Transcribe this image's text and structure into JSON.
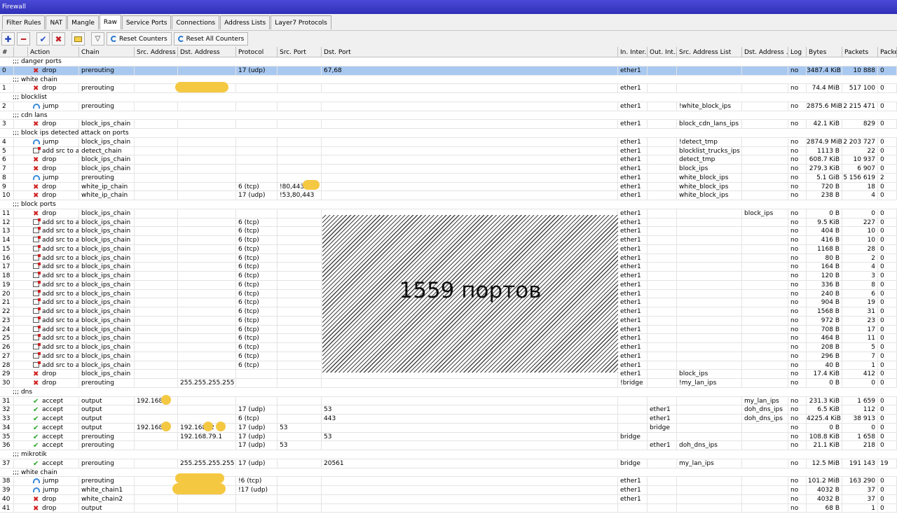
{
  "window": {
    "title": "Firewall"
  },
  "tabs": [
    "Filter Rules",
    "NAT",
    "Mangle",
    "Raw",
    "Service Ports",
    "Connections",
    "Address Lists",
    "Layer7 Protocols"
  ],
  "active_tab": "Raw",
  "toolbar": {
    "reset_counters": "Reset Counters",
    "reset_all_counters": "Reset All Counters"
  },
  "columns": [
    "#",
    "Action",
    "Chain",
    "Src. Address",
    "Dst. Address",
    "Protocol",
    "Src. Port",
    "Dst. Port",
    "In. Inter...",
    "Out. Int...",
    "Src. Address List",
    "Dst. Address ...",
    "Log",
    "Bytes",
    "Packets",
    "Packe"
  ],
  "overlay_text": "1559 портов",
  "rows": [
    {
      "type": "comment",
      "text": ";;; danger ports",
      "sel": true
    },
    {
      "type": "rule",
      "n": "0",
      "icon": "drop",
      "action": "drop",
      "chain": "prerouting",
      "src": "",
      "dst": "",
      "proto": "17 (udp)",
      "sport": "",
      "dport": "67,68",
      "in": "ether1",
      "out": "",
      "srclist": "",
      "dstlist": "",
      "log": "no",
      "bytes": "3487.4 KiB",
      "packets": "10 888",
      "pr": "0",
      "sel": true
    },
    {
      "type": "comment",
      "text": ";;; white chain"
    },
    {
      "type": "rule",
      "n": "1",
      "icon": "drop",
      "action": "drop",
      "chain": "prerouting",
      "src": "",
      "dst": "",
      "proto": "",
      "sport": "",
      "dport": "",
      "in": "ether1",
      "out": "",
      "srclist": "",
      "dstlist": "",
      "log": "no",
      "bytes": "74.4 MiB",
      "packets": "517 100",
      "pr": "0"
    },
    {
      "type": "comment",
      "text": ";;; blocklist"
    },
    {
      "type": "rule",
      "n": "2",
      "icon": "jump",
      "action": "jump",
      "chain": "prerouting",
      "src": "",
      "dst": "",
      "proto": "",
      "sport": "",
      "dport": "",
      "in": "ether1",
      "out": "",
      "srclist": "!white_block_ips",
      "dstlist": "",
      "log": "no",
      "bytes": "2875.6 MiB",
      "packets": "2 215 471",
      "pr": "0"
    },
    {
      "type": "comment",
      "text": ";;; cdn lans"
    },
    {
      "type": "rule",
      "n": "3",
      "icon": "drop",
      "action": "drop",
      "chain": "block_ips_chain",
      "src": "",
      "dst": "",
      "proto": "",
      "sport": "",
      "dport": "",
      "in": "ether1",
      "out": "",
      "srclist": "block_cdn_lans_ips",
      "dstlist": "",
      "log": "no",
      "bytes": "42.1 KiB",
      "packets": "829",
      "pr": "0"
    },
    {
      "type": "comment",
      "text": ";;; block ips detected attack on ports"
    },
    {
      "type": "rule",
      "n": "4",
      "icon": "jump",
      "action": "jump",
      "chain": "block_ips_chain",
      "src": "",
      "dst": "",
      "proto": "",
      "sport": "",
      "dport": "",
      "in": "ether1",
      "out": "",
      "srclist": "!detect_tmp",
      "dstlist": "",
      "log": "no",
      "bytes": "2874.9 MiB",
      "packets": "2 203 727",
      "pr": "0"
    },
    {
      "type": "rule",
      "n": "5",
      "icon": "add",
      "action": "add src to a...",
      "chain": "detect_chain",
      "src": "",
      "dst": "",
      "proto": "",
      "sport": "",
      "dport": "",
      "in": "ether1",
      "out": "",
      "srclist": "blocklist_trucks_ips",
      "dstlist": "",
      "log": "no",
      "bytes": "1113 B",
      "packets": "22",
      "pr": "0"
    },
    {
      "type": "rule",
      "n": "6",
      "icon": "drop",
      "action": "drop",
      "chain": "block_ips_chain",
      "src": "",
      "dst": "",
      "proto": "",
      "sport": "",
      "dport": "",
      "in": "ether1",
      "out": "",
      "srclist": "detect_tmp",
      "dstlist": "",
      "log": "no",
      "bytes": "608.7 KiB",
      "packets": "10 937",
      "pr": "0"
    },
    {
      "type": "rule",
      "n": "7",
      "icon": "drop",
      "action": "drop",
      "chain": "block_ips_chain",
      "src": "",
      "dst": "",
      "proto": "",
      "sport": "",
      "dport": "",
      "in": "ether1",
      "out": "",
      "srclist": "block_ips",
      "dstlist": "",
      "log": "no",
      "bytes": "279.3 KiB",
      "packets": "6 907",
      "pr": "0"
    },
    {
      "type": "rule",
      "n": "8",
      "icon": "jump",
      "action": "jump",
      "chain": "prerouting",
      "src": "",
      "dst": "",
      "proto": "",
      "sport": "",
      "dport": "",
      "in": "ether1",
      "out": "",
      "srclist": "white_block_ips",
      "dstlist": "",
      "log": "no",
      "bytes": "5.1 GiB",
      "packets": "5 156 619",
      "pr": "2"
    },
    {
      "type": "rule",
      "n": "9",
      "icon": "drop",
      "action": "drop",
      "chain": "white_ip_chain",
      "src": "",
      "dst": "",
      "proto": "6 (tcp)",
      "sport": "!80,443,",
      "dport": "",
      "in": "ether1",
      "out": "",
      "srclist": "white_block_ips",
      "dstlist": "",
      "log": "no",
      "bytes": "720 B",
      "packets": "18",
      "pr": "0"
    },
    {
      "type": "rule",
      "n": "10",
      "icon": "drop",
      "action": "drop",
      "chain": "white_ip_chain",
      "src": "",
      "dst": "",
      "proto": "17 (udp)",
      "sport": "!53,80,443",
      "dport": "",
      "in": "ether1",
      "out": "",
      "srclist": "white_block_ips",
      "dstlist": "",
      "log": "no",
      "bytes": "238 B",
      "packets": "4",
      "pr": "0"
    },
    {
      "type": "comment",
      "text": ";;; block ports"
    },
    {
      "type": "rule",
      "n": "11",
      "icon": "drop",
      "action": "drop",
      "chain": "block_ips_chain",
      "src": "",
      "dst": "",
      "proto": "",
      "sport": "",
      "dport": "",
      "in": "ether1",
      "out": "",
      "srclist": "",
      "dstlist": "block_ips",
      "log": "no",
      "bytes": "0 B",
      "packets": "0",
      "pr": "0"
    },
    {
      "type": "rule",
      "n": "12",
      "icon": "add",
      "action": "add src to a...",
      "chain": "block_ips_chain",
      "src": "",
      "dst": "",
      "proto": "6 (tcp)",
      "sport": "",
      "dport": "",
      "in": "ether1",
      "out": "",
      "srclist": "",
      "dstlist": "",
      "log": "no",
      "bytes": "9.5 KiB",
      "packets": "227",
      "pr": "0"
    },
    {
      "type": "rule",
      "n": "13",
      "icon": "add",
      "action": "add src to a...",
      "chain": "block_ips_chain",
      "src": "",
      "dst": "",
      "proto": "6 (tcp)",
      "sport": "",
      "dport": "",
      "in": "ether1",
      "out": "",
      "srclist": "",
      "dstlist": "",
      "log": "no",
      "bytes": "404 B",
      "packets": "10",
      "pr": "0"
    },
    {
      "type": "rule",
      "n": "14",
      "icon": "add",
      "action": "add src to a...",
      "chain": "block_ips_chain",
      "src": "",
      "dst": "",
      "proto": "6 (tcp)",
      "sport": "",
      "dport": "",
      "in": "ether1",
      "out": "",
      "srclist": "",
      "dstlist": "",
      "log": "no",
      "bytes": "416 B",
      "packets": "10",
      "pr": "0"
    },
    {
      "type": "rule",
      "n": "15",
      "icon": "add",
      "action": "add src to a...",
      "chain": "block_ips_chain",
      "src": "",
      "dst": "",
      "proto": "6 (tcp)",
      "sport": "",
      "dport": "",
      "in": "ether1",
      "out": "",
      "srclist": "",
      "dstlist": "",
      "log": "no",
      "bytes": "1168 B",
      "packets": "28",
      "pr": "0"
    },
    {
      "type": "rule",
      "n": "16",
      "icon": "add",
      "action": "add src to a...",
      "chain": "block_ips_chain",
      "src": "",
      "dst": "",
      "proto": "6 (tcp)",
      "sport": "",
      "dport": "",
      "in": "ether1",
      "out": "",
      "srclist": "",
      "dstlist": "",
      "log": "no",
      "bytes": "80 B",
      "packets": "2",
      "pr": "0"
    },
    {
      "type": "rule",
      "n": "17",
      "icon": "add",
      "action": "add src to a...",
      "chain": "block_ips_chain",
      "src": "",
      "dst": "",
      "proto": "6 (tcp)",
      "sport": "",
      "dport": "",
      "in": "ether1",
      "out": "",
      "srclist": "",
      "dstlist": "",
      "log": "no",
      "bytes": "164 B",
      "packets": "4",
      "pr": "0"
    },
    {
      "type": "rule",
      "n": "18",
      "icon": "add",
      "action": "add src to a...",
      "chain": "block_ips_chain",
      "src": "",
      "dst": "",
      "proto": "6 (tcp)",
      "sport": "",
      "dport": "",
      "in": "ether1",
      "out": "",
      "srclist": "",
      "dstlist": "",
      "log": "no",
      "bytes": "120 B",
      "packets": "3",
      "pr": "0"
    },
    {
      "type": "rule",
      "n": "19",
      "icon": "add",
      "action": "add src to a...",
      "chain": "block_ips_chain",
      "src": "",
      "dst": "",
      "proto": "6 (tcp)",
      "sport": "",
      "dport": "",
      "in": "ether1",
      "out": "",
      "srclist": "",
      "dstlist": "",
      "log": "no",
      "bytes": "336 B",
      "packets": "8",
      "pr": "0"
    },
    {
      "type": "rule",
      "n": "20",
      "icon": "add",
      "action": "add src to a...",
      "chain": "block_ips_chain",
      "src": "",
      "dst": "",
      "proto": "6 (tcp)",
      "sport": "",
      "dport": "",
      "in": "ether1",
      "out": "",
      "srclist": "",
      "dstlist": "",
      "log": "no",
      "bytes": "240 B",
      "packets": "6",
      "pr": "0"
    },
    {
      "type": "rule",
      "n": "21",
      "icon": "add",
      "action": "add src to a...",
      "chain": "block_ips_chain",
      "src": "",
      "dst": "",
      "proto": "6 (tcp)",
      "sport": "",
      "dport": "",
      "in": "ether1",
      "out": "",
      "srclist": "",
      "dstlist": "",
      "log": "no",
      "bytes": "904 B",
      "packets": "19",
      "pr": "0"
    },
    {
      "type": "rule",
      "n": "22",
      "icon": "add",
      "action": "add src to a...",
      "chain": "block_ips_chain",
      "src": "",
      "dst": "",
      "proto": "6 (tcp)",
      "sport": "",
      "dport": "",
      "in": "ether1",
      "out": "",
      "srclist": "",
      "dstlist": "",
      "log": "no",
      "bytes": "1568 B",
      "packets": "31",
      "pr": "0"
    },
    {
      "type": "rule",
      "n": "23",
      "icon": "add",
      "action": "add src to a...",
      "chain": "block_ips_chain",
      "src": "",
      "dst": "",
      "proto": "6 (tcp)",
      "sport": "",
      "dport": "",
      "in": "ether1",
      "out": "",
      "srclist": "",
      "dstlist": "",
      "log": "no",
      "bytes": "972 B",
      "packets": "23",
      "pr": "0"
    },
    {
      "type": "rule",
      "n": "24",
      "icon": "add",
      "action": "add src to a...",
      "chain": "block_ips_chain",
      "src": "",
      "dst": "",
      "proto": "6 (tcp)",
      "sport": "",
      "dport": "",
      "in": "ether1",
      "out": "",
      "srclist": "",
      "dstlist": "",
      "log": "no",
      "bytes": "708 B",
      "packets": "17",
      "pr": "0"
    },
    {
      "type": "rule",
      "n": "25",
      "icon": "add",
      "action": "add src to a...",
      "chain": "block_ips_chain",
      "src": "",
      "dst": "",
      "proto": "6 (tcp)",
      "sport": "",
      "dport": "",
      "in": "ether1",
      "out": "",
      "srclist": "",
      "dstlist": "",
      "log": "no",
      "bytes": "464 B",
      "packets": "11",
      "pr": "0"
    },
    {
      "type": "rule",
      "n": "26",
      "icon": "add",
      "action": "add src to a...",
      "chain": "block_ips_chain",
      "src": "",
      "dst": "",
      "proto": "6 (tcp)",
      "sport": "",
      "dport": "",
      "in": "ether1",
      "out": "",
      "srclist": "",
      "dstlist": "",
      "log": "no",
      "bytes": "208 B",
      "packets": "5",
      "pr": "0"
    },
    {
      "type": "rule",
      "n": "27",
      "icon": "add",
      "action": "add src to a...",
      "chain": "block_ips_chain",
      "src": "",
      "dst": "",
      "proto": "6 (tcp)",
      "sport": "",
      "dport": "",
      "in": "ether1",
      "out": "",
      "srclist": "",
      "dstlist": "",
      "log": "no",
      "bytes": "296 B",
      "packets": "7",
      "pr": "0"
    },
    {
      "type": "rule",
      "n": "28",
      "icon": "add",
      "action": "add src to a...",
      "chain": "block_ips_chain",
      "src": "",
      "dst": "",
      "proto": "6 (tcp)",
      "sport": "",
      "dport": "",
      "in": "ether1",
      "out": "",
      "srclist": "",
      "dstlist": "",
      "log": "no",
      "bytes": "40 B",
      "packets": "1",
      "pr": "0"
    },
    {
      "type": "rule",
      "n": "29",
      "icon": "drop",
      "action": "drop",
      "chain": "block_ips_chain",
      "src": "",
      "dst": "",
      "proto": "",
      "sport": "",
      "dport": "",
      "in": "ether1",
      "out": "",
      "srclist": "block_ips",
      "dstlist": "",
      "log": "no",
      "bytes": "17.4 KiB",
      "packets": "412",
      "pr": "0"
    },
    {
      "type": "rule",
      "n": "30",
      "icon": "drop",
      "action": "drop",
      "chain": "prerouting",
      "src": "",
      "dst": "255.255.255.255",
      "proto": "",
      "sport": "",
      "dport": "",
      "in": "!bridge",
      "out": "",
      "srclist": "!my_lan_ips",
      "dstlist": "",
      "log": "no",
      "bytes": "0 B",
      "packets": "0",
      "pr": "0"
    },
    {
      "type": "comment",
      "text": ";;; dns"
    },
    {
      "type": "rule",
      "n": "31",
      "icon": "accept",
      "action": "accept",
      "chain": "output",
      "src": "192.168.    1",
      "dst": "",
      "proto": "",
      "sport": "",
      "dport": "",
      "in": "",
      "out": "",
      "srclist": "",
      "dstlist": "my_lan_ips",
      "log": "no",
      "bytes": "231.3 KiB",
      "packets": "1 659",
      "pr": "0"
    },
    {
      "type": "rule",
      "n": "32",
      "icon": "accept",
      "action": "accept",
      "chain": "output",
      "src": "",
      "dst": "",
      "proto": "17 (udp)",
      "sport": "",
      "dport": "53",
      "in": "",
      "out": "ether1",
      "srclist": "",
      "dstlist": "doh_dns_ips",
      "log": "no",
      "bytes": "6.5 KiB",
      "packets": "112",
      "pr": "0"
    },
    {
      "type": "rule",
      "n": "33",
      "icon": "accept",
      "action": "accept",
      "chain": "output",
      "src": "",
      "dst": "",
      "proto": "6 (tcp)",
      "sport": "",
      "dport": "443",
      "in": "",
      "out": "ether1",
      "srclist": "",
      "dstlist": "doh_dns_ips",
      "log": "no",
      "bytes": "4225.4 KiB",
      "packets": "38 913",
      "pr": "0"
    },
    {
      "type": "rule",
      "n": "34",
      "icon": "accept",
      "action": "accept",
      "chain": "output",
      "src": "192.168.    1",
      "dst": "192.168.    2",
      "proto": "17 (udp)",
      "sport": "53",
      "dport": "",
      "in": "",
      "out": "bridge",
      "srclist": "",
      "dstlist": "",
      "log": "no",
      "bytes": "0 B",
      "packets": "0",
      "pr": "0"
    },
    {
      "type": "rule",
      "n": "35",
      "icon": "accept",
      "action": "accept",
      "chain": "prerouting",
      "src": "",
      "dst": "192.168.79.1",
      "proto": "17 (udp)",
      "sport": "",
      "dport": "53",
      "in": "bridge",
      "out": "",
      "srclist": "",
      "dstlist": "",
      "log": "no",
      "bytes": "108.8 KiB",
      "packets": "1 658",
      "pr": "0"
    },
    {
      "type": "rule",
      "n": "36",
      "icon": "accept",
      "action": "accept",
      "chain": "prerouting",
      "src": "",
      "dst": "",
      "proto": "17 (udp)",
      "sport": "53",
      "dport": "",
      "in": "",
      "out": "ether1",
      "srclist": "doh_dns_ips",
      "dstlist": "",
      "log": "no",
      "bytes": "21.1 KiB",
      "packets": "218",
      "pr": "0"
    },
    {
      "type": "comment",
      "text": ";;; mikrotik"
    },
    {
      "type": "rule",
      "n": "37",
      "icon": "accept",
      "action": "accept",
      "chain": "prerouting",
      "src": "",
      "dst": "255.255.255.255",
      "proto": "17 (udp)",
      "sport": "",
      "dport": "20561",
      "in": "bridge",
      "out": "",
      "srclist": "my_lan_ips",
      "dstlist": "",
      "log": "no",
      "bytes": "12.5 MiB",
      "packets": "191 143",
      "pr": "19"
    },
    {
      "type": "comment",
      "text": ";;; white chain"
    },
    {
      "type": "rule",
      "n": "38",
      "icon": "jump",
      "action": "jump",
      "chain": "prerouting",
      "src": "",
      "dst": "",
      "proto": "!6 (tcp)",
      "sport": "",
      "dport": "",
      "in": "ether1",
      "out": "",
      "srclist": "",
      "dstlist": "",
      "log": "no",
      "bytes": "101.2 MiB",
      "packets": "163 290",
      "pr": "0"
    },
    {
      "type": "rule",
      "n": "39",
      "icon": "jump",
      "action": "jump",
      "chain": "white_chain1",
      "src": "",
      "dst": "",
      "proto": "!17 (udp)",
      "sport": "",
      "dport": "",
      "in": "ether1",
      "out": "",
      "srclist": "",
      "dstlist": "",
      "log": "no",
      "bytes": "4032 B",
      "packets": "37",
      "pr": "0"
    },
    {
      "type": "rule",
      "n": "40",
      "icon": "drop",
      "action": "drop",
      "chain": "white_chain2",
      "src": "",
      "dst": "",
      "proto": "",
      "sport": "",
      "dport": "",
      "in": "ether1",
      "out": "",
      "srclist": "",
      "dstlist": "",
      "log": "no",
      "bytes": "4032 B",
      "packets": "37",
      "pr": "0"
    },
    {
      "type": "rule",
      "n": "41",
      "icon": "drop",
      "action": "drop",
      "chain": "output",
      "src": "",
      "dst": "",
      "proto": "",
      "sport": "",
      "dport": "",
      "in": "",
      "out": "",
      "srclist": "",
      "dstlist": "",
      "log": "no",
      "bytes": "68 B",
      "packets": "1",
      "pr": "0"
    }
  ]
}
